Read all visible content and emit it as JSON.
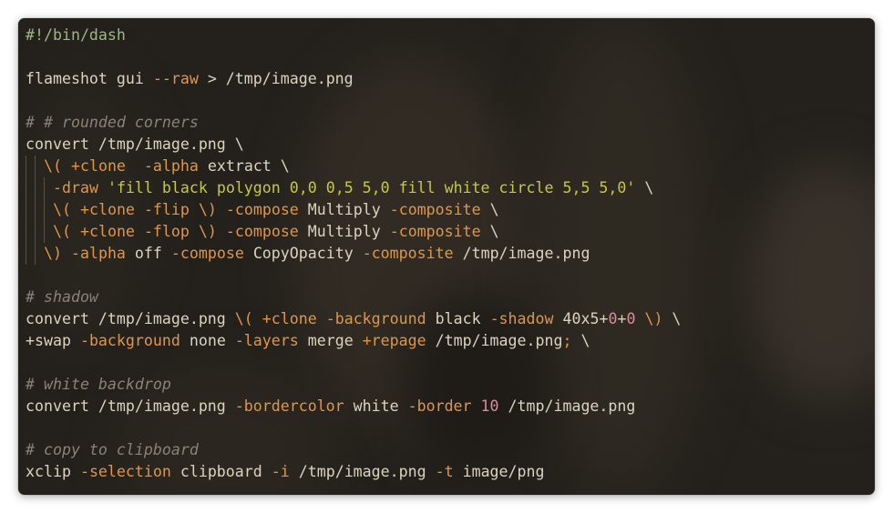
{
  "window": {
    "background": "#24211c"
  },
  "colors": {
    "text": "#dcd3bf",
    "shebang": "#9ab880",
    "flag": "#e09548",
    "comment": "#8b8176",
    "string": "#c6c744",
    "operator": "#e09548",
    "number": "#d98c9a"
  },
  "lines": [
    {
      "indent": 0,
      "tokens": [
        {
          "t": "shebang",
          "v": "#!/bin/dash"
        }
      ]
    },
    {
      "indent": 0,
      "tokens": []
    },
    {
      "indent": 0,
      "tokens": [
        {
          "t": "text",
          "v": "flameshot gui "
        },
        {
          "t": "flag",
          "v": "--raw"
        },
        {
          "t": "text",
          "v": " > /tmp/image.png"
        }
      ]
    },
    {
      "indent": 0,
      "tokens": []
    },
    {
      "indent": 0,
      "tokens": [
        {
          "t": "comment",
          "v": "# # rounded corners"
        }
      ]
    },
    {
      "indent": 0,
      "tokens": [
        {
          "t": "text",
          "v": "convert /tmp/image.png \\"
        }
      ]
    },
    {
      "indent": 2,
      "tokens": [
        {
          "t": "op",
          "v": "\\("
        },
        {
          "t": "text",
          "v": " "
        },
        {
          "t": "flag",
          "v": "+clone"
        },
        {
          "t": "text",
          "v": "  "
        },
        {
          "t": "flag",
          "v": "-alpha"
        },
        {
          "t": "text",
          "v": " extract \\"
        }
      ]
    },
    {
      "indent": 3,
      "tokens": [
        {
          "t": "flag",
          "v": "-draw"
        },
        {
          "t": "text",
          "v": " "
        },
        {
          "t": "string",
          "v": "'fill black polygon 0,0 0,5 5,0 fill white circle 5,5 5,0'"
        },
        {
          "t": "text",
          "v": " \\"
        }
      ]
    },
    {
      "indent": 3,
      "tokens": [
        {
          "t": "op",
          "v": "\\("
        },
        {
          "t": "text",
          "v": " "
        },
        {
          "t": "flag",
          "v": "+clone"
        },
        {
          "t": "text",
          "v": " "
        },
        {
          "t": "flag",
          "v": "-flip"
        },
        {
          "t": "text",
          "v": " "
        },
        {
          "t": "op",
          "v": "\\)"
        },
        {
          "t": "text",
          "v": " "
        },
        {
          "t": "flag",
          "v": "-compose"
        },
        {
          "t": "text",
          "v": " Multiply "
        },
        {
          "t": "flag",
          "v": "-composite"
        },
        {
          "t": "text",
          "v": " \\"
        }
      ]
    },
    {
      "indent": 3,
      "tokens": [
        {
          "t": "op",
          "v": "\\("
        },
        {
          "t": "text",
          "v": " "
        },
        {
          "t": "flag",
          "v": "+clone"
        },
        {
          "t": "text",
          "v": " "
        },
        {
          "t": "flag",
          "v": "-flop"
        },
        {
          "t": "text",
          "v": " "
        },
        {
          "t": "op",
          "v": "\\)"
        },
        {
          "t": "text",
          "v": " "
        },
        {
          "t": "flag",
          "v": "-compose"
        },
        {
          "t": "text",
          "v": " Multiply "
        },
        {
          "t": "flag",
          "v": "-composite"
        },
        {
          "t": "text",
          "v": " \\"
        }
      ]
    },
    {
      "indent": 2,
      "tokens": [
        {
          "t": "op",
          "v": "\\)"
        },
        {
          "t": "text",
          "v": " "
        },
        {
          "t": "flag",
          "v": "-alpha"
        },
        {
          "t": "text",
          "v": " off "
        },
        {
          "t": "flag",
          "v": "-compose"
        },
        {
          "t": "text",
          "v": " CopyOpacity "
        },
        {
          "t": "flag",
          "v": "-composite"
        },
        {
          "t": "text",
          "v": " /tmp/image.png"
        }
      ]
    },
    {
      "indent": 0,
      "tokens": []
    },
    {
      "indent": 0,
      "tokens": [
        {
          "t": "comment",
          "v": "# shadow"
        }
      ]
    },
    {
      "indent": 0,
      "tokens": [
        {
          "t": "text",
          "v": "convert /tmp/image.png "
        },
        {
          "t": "op",
          "v": "\\("
        },
        {
          "t": "text",
          "v": " "
        },
        {
          "t": "flag",
          "v": "+clone"
        },
        {
          "t": "text",
          "v": " "
        },
        {
          "t": "flag",
          "v": "-background"
        },
        {
          "t": "text",
          "v": " black "
        },
        {
          "t": "flag",
          "v": "-shadow"
        },
        {
          "t": "text",
          "v": " 40x5+"
        },
        {
          "t": "number",
          "v": "0"
        },
        {
          "t": "text",
          "v": "+"
        },
        {
          "t": "number",
          "v": "0"
        },
        {
          "t": "text",
          "v": " "
        },
        {
          "t": "op",
          "v": "\\)"
        },
        {
          "t": "text",
          "v": " \\"
        }
      ]
    },
    {
      "indent": 0,
      "tokens": [
        {
          "t": "text",
          "v": "+swap "
        },
        {
          "t": "flag",
          "v": "-background"
        },
        {
          "t": "text",
          "v": " none "
        },
        {
          "t": "flag",
          "v": "-layers"
        },
        {
          "t": "text",
          "v": " merge "
        },
        {
          "t": "flag",
          "v": "+repage"
        },
        {
          "t": "text",
          "v": " /tmp/image.png"
        },
        {
          "t": "op",
          "v": ";"
        },
        {
          "t": "text",
          "v": " \\"
        }
      ]
    },
    {
      "indent": 0,
      "tokens": []
    },
    {
      "indent": 0,
      "tokens": [
        {
          "t": "comment",
          "v": "# white backdrop"
        }
      ]
    },
    {
      "indent": 0,
      "tokens": [
        {
          "t": "text",
          "v": "convert /tmp/image.png "
        },
        {
          "t": "flag",
          "v": "-bordercolor"
        },
        {
          "t": "text",
          "v": " white "
        },
        {
          "t": "flag",
          "v": "-border"
        },
        {
          "t": "text",
          "v": " "
        },
        {
          "t": "number",
          "v": "10"
        },
        {
          "t": "text",
          "v": " /tmp/image.png"
        }
      ]
    },
    {
      "indent": 0,
      "tokens": []
    },
    {
      "indent": 0,
      "tokens": [
        {
          "t": "comment",
          "v": "# copy to clipboard"
        }
      ]
    },
    {
      "indent": 0,
      "tokens": [
        {
          "t": "text",
          "v": "xclip "
        },
        {
          "t": "flag",
          "v": "-selection"
        },
        {
          "t": "text",
          "v": " clipboard "
        },
        {
          "t": "flag",
          "v": "-i"
        },
        {
          "t": "text",
          "v": " /tmp/image.png "
        },
        {
          "t": "flag",
          "v": "-t"
        },
        {
          "t": "text",
          "v": " image/png"
        }
      ]
    }
  ]
}
